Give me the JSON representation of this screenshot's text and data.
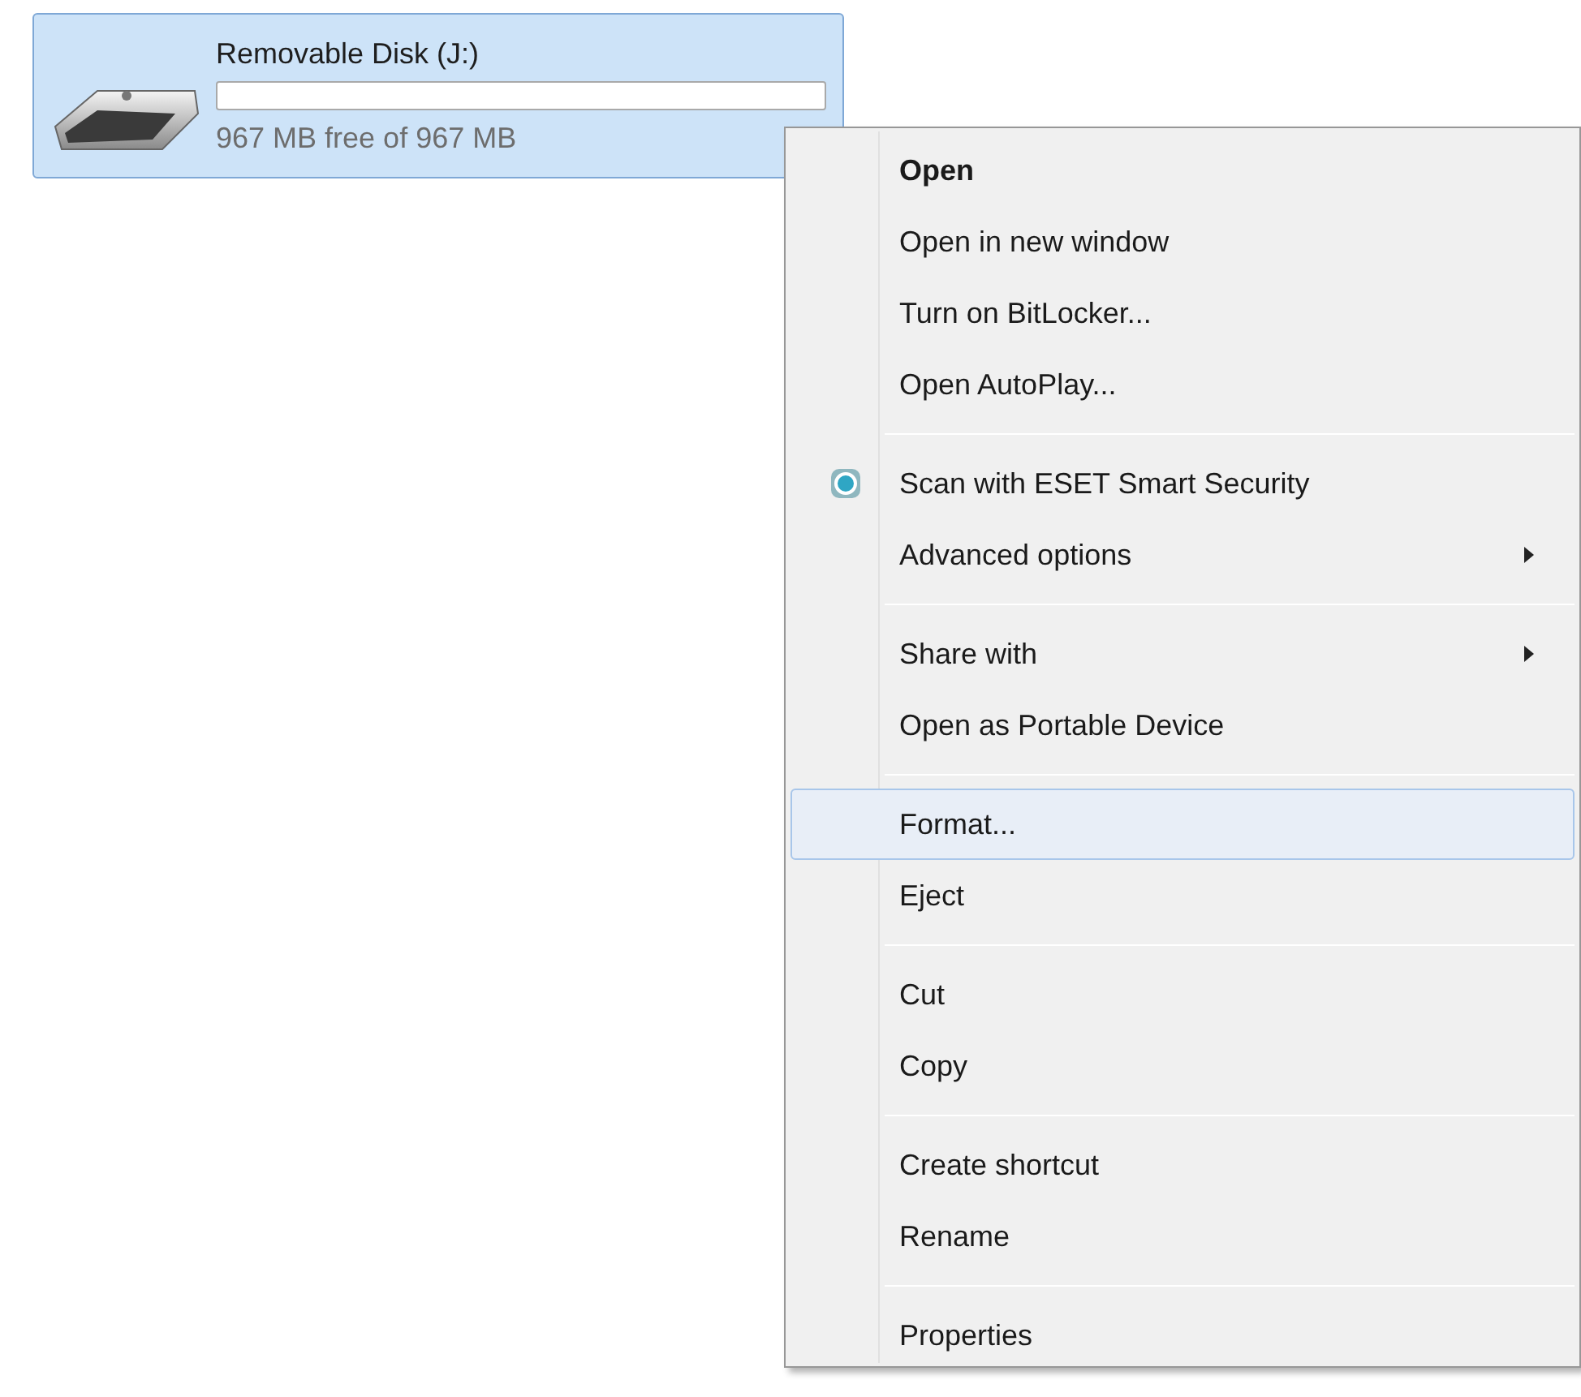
{
  "drive": {
    "name": "Removable Disk (J:)",
    "usage": {
      "level": 0
    },
    "free_text": "967 MB free of 967 MB",
    "selected": true
  },
  "context_menu": {
    "groups": [
      {
        "items": [
          {
            "label": "Open",
            "default": true,
            "submenu": false,
            "icon": false,
            "selected": false
          },
          {
            "label": "Open in new window",
            "default": false,
            "submenu": false,
            "icon": false,
            "selected": false
          },
          {
            "label": "Turn on BitLocker...",
            "default": false,
            "submenu": false,
            "icon": false,
            "selected": false
          },
          {
            "label": "Open AutoPlay...",
            "default": false,
            "submenu": false,
            "icon": false,
            "selected": false
          }
        ]
      },
      {
        "items": [
          {
            "label": "Scan with ESET Smart Security",
            "default": false,
            "submenu": false,
            "icon": true,
            "selected": false
          },
          {
            "label": "Advanced options",
            "default": false,
            "submenu": true,
            "icon": false,
            "selected": false
          }
        ]
      },
      {
        "items": [
          {
            "label": "Share with",
            "default": false,
            "submenu": true,
            "icon": false,
            "selected": false
          },
          {
            "label": "Open as Portable Device",
            "default": false,
            "submenu": false,
            "icon": false,
            "selected": false
          }
        ]
      },
      {
        "items": [
          {
            "label": "Format...",
            "default": false,
            "submenu": false,
            "icon": false,
            "selected": true
          },
          {
            "label": "Eject",
            "default": false,
            "submenu": false,
            "icon": false,
            "selected": false
          }
        ]
      },
      {
        "items": [
          {
            "label": "Cut",
            "default": false,
            "submenu": false,
            "icon": false,
            "selected": false
          },
          {
            "label": "Copy",
            "default": false,
            "submenu": false,
            "icon": false,
            "selected": false
          }
        ]
      },
      {
        "items": [
          {
            "label": "Create shortcut",
            "default": false,
            "submenu": false,
            "icon": false,
            "selected": false
          },
          {
            "label": "Rename",
            "default": false,
            "submenu": false,
            "icon": false,
            "selected": false
          }
        ]
      },
      {
        "items": [
          {
            "label": "Properties",
            "default": false,
            "submenu": false,
            "icon": false,
            "selected": false
          }
        ]
      }
    ]
  }
}
